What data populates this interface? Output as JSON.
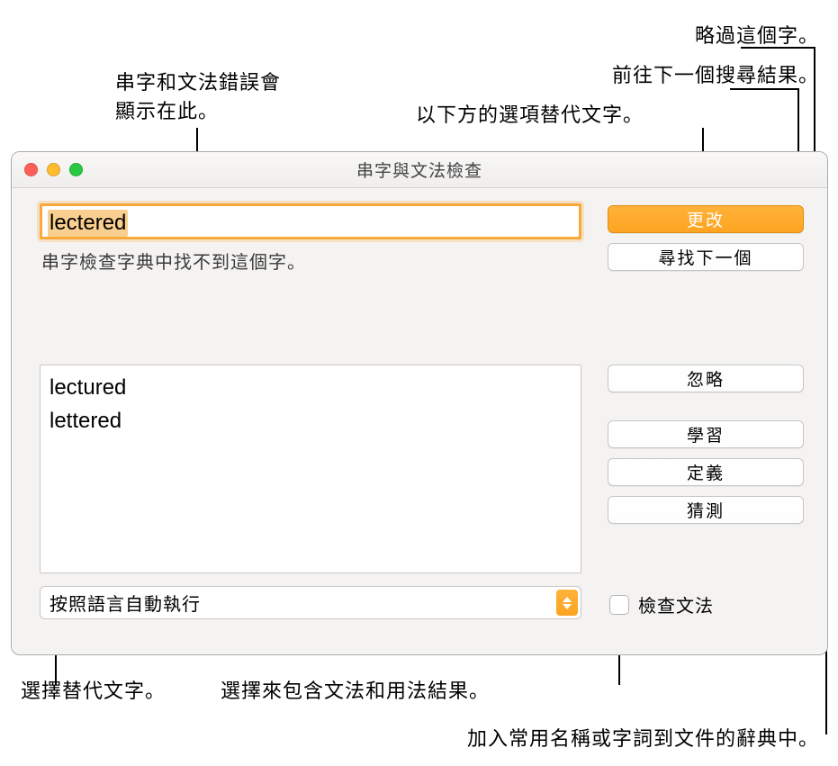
{
  "callouts": {
    "errors_here": "串字和文法錯誤會\n顯示在此。",
    "replace_below": "以下方的選項替代文字。",
    "next_result": "前往下一個搜尋結果。",
    "skip_word": "略過這個字。",
    "choose_replacement": "選擇替代文字。",
    "include_grammar": "選擇來包含文法和用法結果。",
    "add_to_dict": "加入常用名稱或字詞到文件的辭典中。"
  },
  "window": {
    "title": "串字與文法檢查",
    "misspelled_word": "lectered",
    "hint": "串字檢查字典中找不到這個字。",
    "suggestions": [
      "lectured",
      "lettered"
    ],
    "language_select": "按照語言自動執行",
    "buttons": {
      "change": "更改",
      "find_next": "尋找下一個",
      "ignore": "忽略",
      "learn": "學習",
      "define": "定義",
      "guess": "猜測"
    },
    "check_grammar_label": "檢查文法"
  }
}
